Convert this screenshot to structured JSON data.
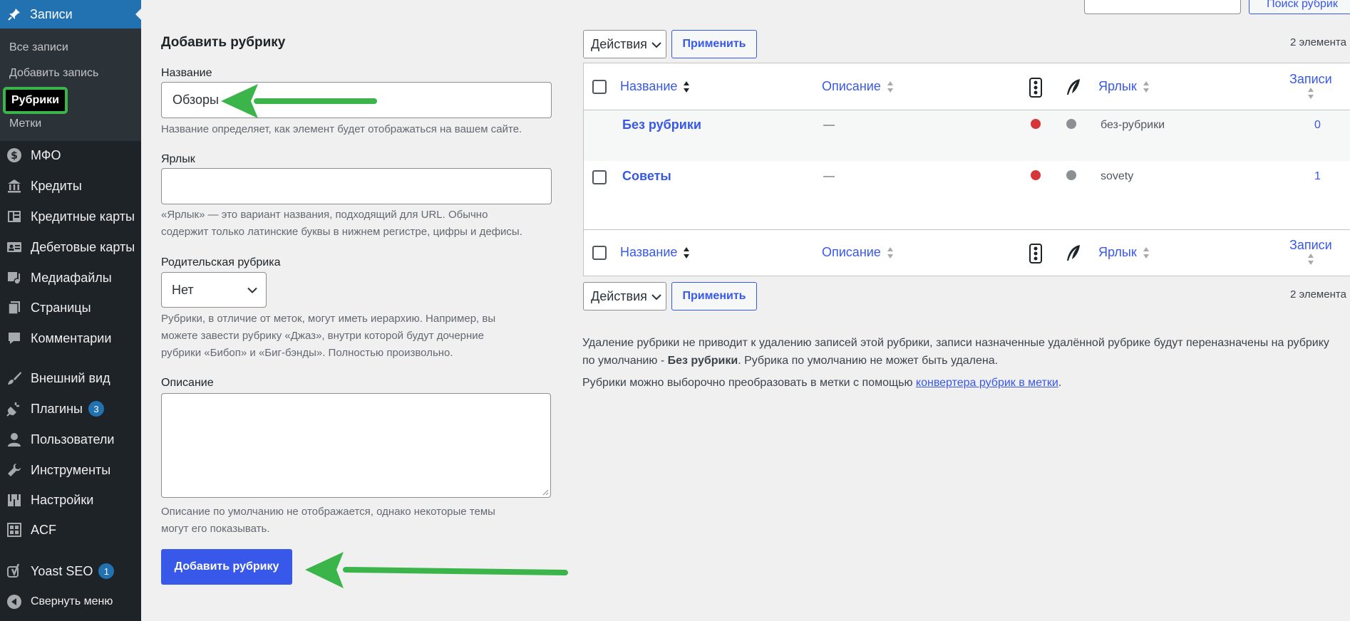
{
  "sidebar": {
    "current_menu": "Записи",
    "submenu": {
      "all_posts": "Все записи",
      "add_post": "Добавить запись",
      "categories": "Рубрики",
      "tags": "Метки"
    },
    "items": [
      {
        "label": "МФО",
        "icon": "dollar-icon"
      },
      {
        "label": "Кредиты",
        "icon": "bank-icon"
      },
      {
        "label": "Кредитные карты",
        "icon": "columns-icon"
      },
      {
        "label": "Дебетовые карты",
        "icon": "id-card-icon"
      },
      {
        "label": "Медиафайлы",
        "icon": "media-icon"
      },
      {
        "label": "Страницы",
        "icon": "pages-icon"
      },
      {
        "label": "Комментарии",
        "icon": "comment-icon"
      },
      {
        "label": "Внешний вид",
        "icon": "brush-icon"
      },
      {
        "label": "Плагины",
        "icon": "plugin-icon",
        "badge": "3"
      },
      {
        "label": "Пользователи",
        "icon": "user-icon"
      },
      {
        "label": "Инструменты",
        "icon": "wrench-icon"
      },
      {
        "label": "Настройки",
        "icon": "settings-icon"
      },
      {
        "label": "ACF",
        "icon": "acf-icon"
      },
      {
        "label": "Yoast SEO",
        "icon": "yoast-icon",
        "badge": "1"
      },
      {
        "label": "Свернуть меню",
        "icon": "collapse-icon"
      }
    ]
  },
  "search": {
    "button_label": "Поиск рубрик"
  },
  "form": {
    "title": "Добавить рубрику",
    "name_label": "Название",
    "name_value": "Обзоры",
    "name_help": "Название определяет, как элемент будет отображаться на вашем сайте.",
    "slug_label": "Ярлык",
    "slug_value": "",
    "slug_help_1": "«Ярлык» — это вариант названия, подходящий для URL. Обычно",
    "slug_help_2": "содержит только латинские буквы в нижнем регистре, цифры и дефисы.",
    "parent_label": "Родительская рубрика",
    "parent_value": "Нет",
    "parent_help_1": "Рубрики, в отличие от меток, могут иметь иерархию. Например, вы",
    "parent_help_2": "можете завести рубрику «Джаз», внутри которой будут дочерние",
    "parent_help_3": "рубрики «Бибоп» и «Биг-бэнды». Полностью произвольно.",
    "desc_label": "Описание",
    "desc_value": "",
    "desc_help_1": "Описание по умолчанию не отображается, однако некоторые темы",
    "desc_help_2": "могут его показывать.",
    "submit_label": "Добавить рубрику"
  },
  "bulk": {
    "actions_label": "Действия",
    "apply_label": "Применить",
    "count": "2 элемента"
  },
  "table": {
    "headers": {
      "name": "Название",
      "description": "Описание",
      "slug": "Ярлык",
      "count": "Записи"
    },
    "rows": [
      {
        "name": "Без рубрики",
        "description": "—",
        "slug": "без-рубрики",
        "count": "0"
      },
      {
        "name": "Советы",
        "description": "—",
        "slug": "sovety",
        "count": "1"
      }
    ]
  },
  "notes": {
    "p1_a": "Удаление рубрики не приводит к удалению записей этой рубрики, записи назначенные удалённой рубрике будут переназначены на рубрику",
    "p1_b": "по умолчанию - ",
    "p1_bold": "Без рубрики",
    "p1_c": ". Рубрика по умолчанию не может быть удалена.",
    "p2_a": "Рубрики можно выборочно преобразовать в метки с помощью ",
    "p2_link": "конвертера рубрик в метки",
    "p2_b": "."
  },
  "colors": {
    "accent": "#3858e9",
    "annotation_arrow": "#3bb54a",
    "status_red": "#d63638",
    "status_gray": "#8c8f94"
  }
}
